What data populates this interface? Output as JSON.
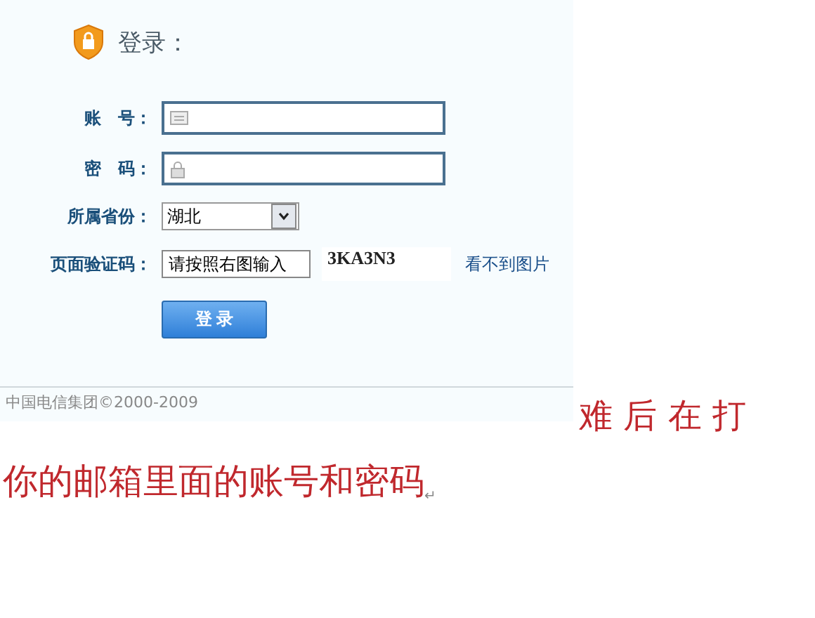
{
  "login": {
    "title": "登录：",
    "fields": [
      {
        "kind": "text",
        "label": "账　号："
      },
      {
        "kind": "password",
        "label": "密　码："
      }
    ],
    "province": {
      "label": "所属省份：",
      "value": "湖北"
    },
    "captcha": {
      "label": "页面验证码：",
      "placeholder": "请按照右图输入",
      "code": "3KA3N3",
      "link": "看不到图片"
    },
    "button": "登 录",
    "footer": "中国电信集团©2000-2009"
  },
  "note": {
    "line_1": "难 后 在 打",
    "line_2": "你的邮箱里面的账号和密码",
    "return_mark": "↵"
  }
}
